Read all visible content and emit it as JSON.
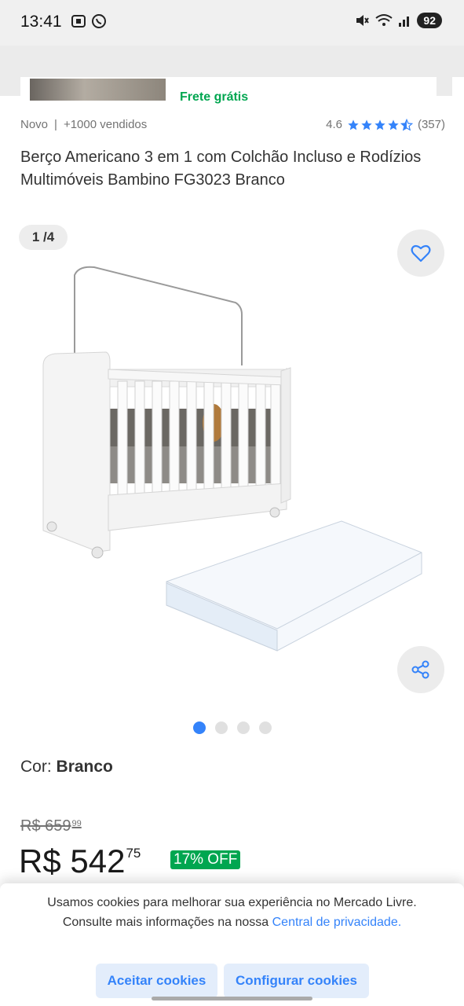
{
  "status": {
    "time": "13:41",
    "battery": "92"
  },
  "top": {
    "shipping": "Frete grátis"
  },
  "meta": {
    "condition": "Novo",
    "separator": "|",
    "sold": "+1000 vendidos",
    "rating": "4.6",
    "reviews": "(357)",
    "stars": 4.5
  },
  "title": "Berço Americano 3 em 1 com Colchão Incluso e Rodízios Multimóveis Bambino FG3023 Branco",
  "gallery": {
    "counter": "1 /4",
    "total_images": 4,
    "active_index": 0
  },
  "color": {
    "label": "Cor:",
    "value": "Branco"
  },
  "pricing": {
    "old_int": "R$ 659",
    "old_cents": "99",
    "price_int": "R$ 542",
    "price_cents": "75",
    "discount": "17% OFF"
  },
  "cookie": {
    "text": "Usamos cookies para melhorar sua experiência no Mercado Livre. Consulte mais informações na nossa",
    "link": "Central de privacidade.",
    "accept": "Aceitar cookies",
    "configure": "Configurar cookies"
  },
  "colors": {
    "accent": "#3483fa",
    "green": "#00a650"
  }
}
